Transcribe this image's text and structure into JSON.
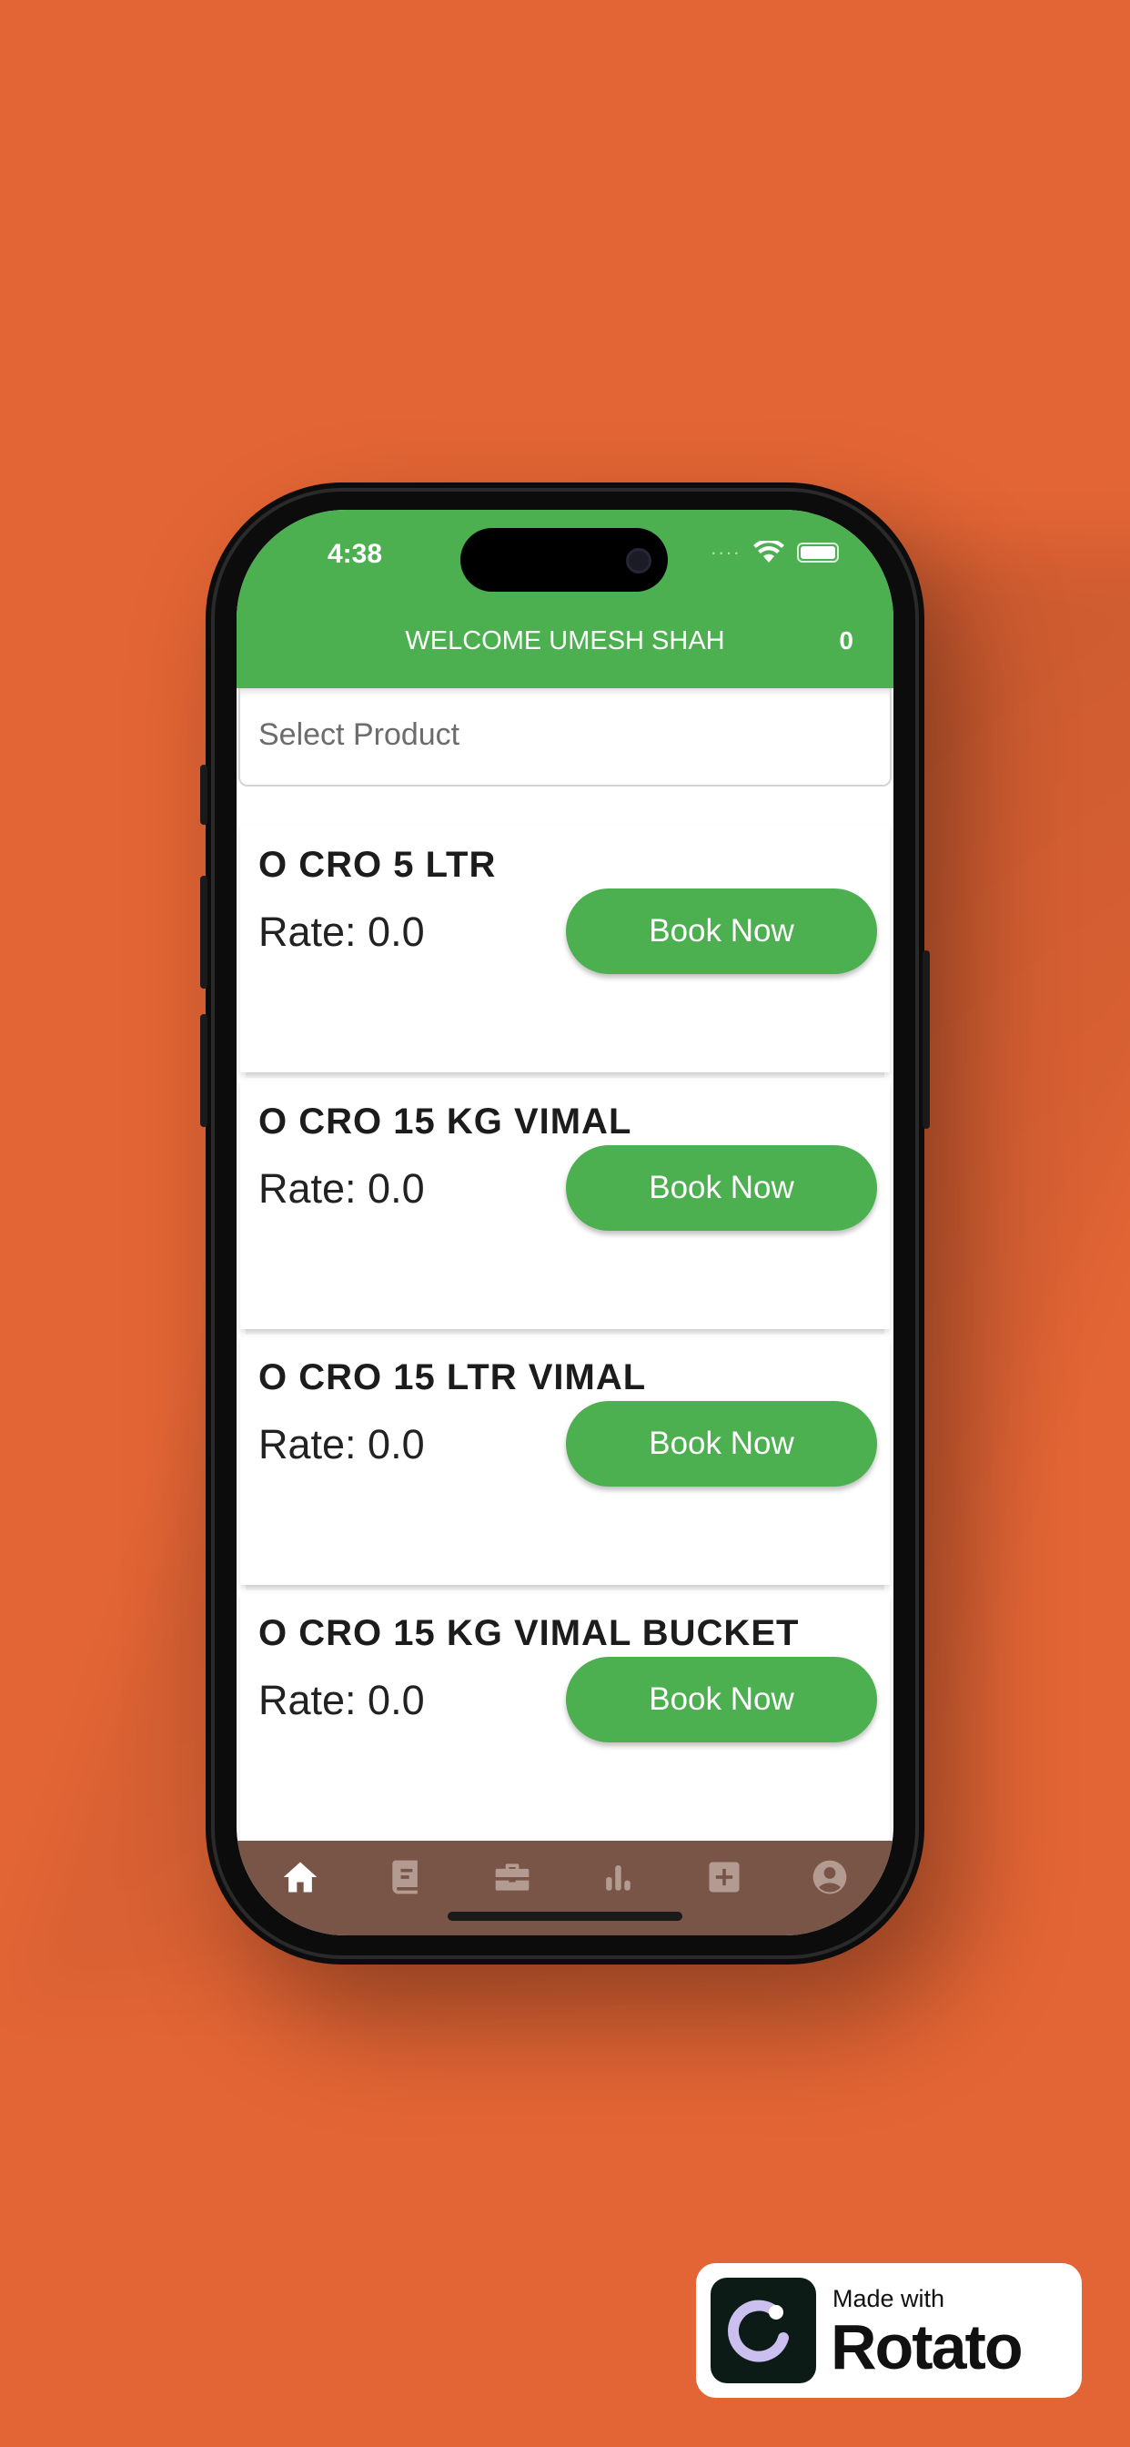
{
  "status_bar": {
    "time": "4:38",
    "signal_dots": "····"
  },
  "header": {
    "welcome_text": "WELCOME UMESH SHAH",
    "cart_count": "0"
  },
  "search": {
    "placeholder": "Select Product"
  },
  "products": [
    {
      "name": "O CRO 5 LTR",
      "rate": "Rate: 0.0",
      "button": "Book Now"
    },
    {
      "name": "O CRO 15 KG VIMAL",
      "rate": "Rate: 0.0",
      "button": "Book Now"
    },
    {
      "name": "O CRO 15 LTR VIMAL",
      "rate": "Rate: 0.0",
      "button": "Book Now"
    },
    {
      "name": "O CRO 15 KG VIMAL BUCKET",
      "rate": "Rate: 0.0",
      "button": "Book Now"
    }
  ],
  "tab_bar": {
    "items": [
      {
        "icon": "home-icon",
        "active": true
      },
      {
        "icon": "book-icon",
        "active": false
      },
      {
        "icon": "briefcase-icon",
        "active": false
      },
      {
        "icon": "bar-chart-icon",
        "active": false
      },
      {
        "icon": "add-box-icon",
        "active": false
      },
      {
        "icon": "account-icon",
        "active": false
      }
    ]
  },
  "badge": {
    "small_text": "Made with",
    "big_text": "Rotato"
  },
  "colors": {
    "background": "#E36535",
    "primary": "#4CAF50",
    "tab_bar": "#795548",
    "tab_active": "#ffffff",
    "tab_inactive": "#b39b91"
  }
}
